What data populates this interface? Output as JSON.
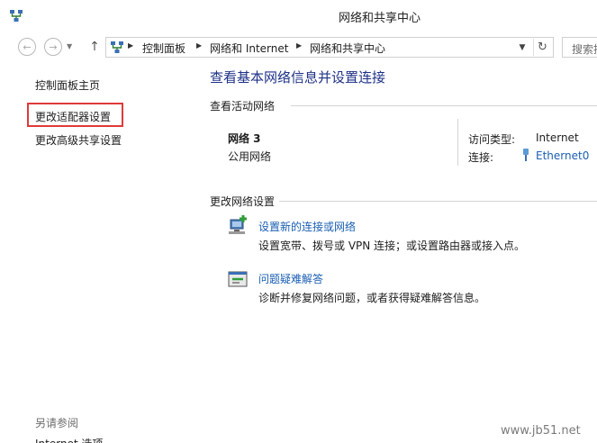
{
  "window": {
    "title": "网络和共享中心",
    "app_icon": "network-icon"
  },
  "nav": {
    "back_icon": "back-arrow-icon",
    "forward_icon": "forward-arrow-icon",
    "up_icon": "up-arrow-icon"
  },
  "address": {
    "crumbs": [
      "控制面板",
      "网络和 Internet",
      "网络和共享中心"
    ],
    "dropdown_icon": "chevron-down-icon",
    "refresh_icon": "refresh-icon"
  },
  "search": {
    "placeholder": "搜索控"
  },
  "sidebar": {
    "items": [
      {
        "label": "控制面板主页"
      },
      {
        "label": "更改适配器设置",
        "highlighted": true
      },
      {
        "label": "更改高级共享设置"
      }
    ],
    "see_also": "另请参阅",
    "see_also_items": [
      {
        "label": "Internet 选项"
      }
    ],
    "highlight_color": "#e03a3a"
  },
  "main": {
    "title": "查看基本网络信息并设置连接",
    "active_networks_header": "查看活动网络",
    "network": {
      "name": "网络  3",
      "category": "公用网络",
      "access_type_label": "访问类型:",
      "access_type_value": "Internet",
      "connection_label": "连接:",
      "connection_value": "Ethernet0",
      "connection_icon": "ethernet-icon"
    },
    "change_settings_header": "更改网络设置",
    "tasks": [
      {
        "icon": "new-connection-icon",
        "link": "设置新的连接或网络",
        "desc": "设置宽带、拨号或 VPN 连接；或设置路由器或接入点。"
      },
      {
        "icon": "troubleshoot-icon",
        "link": "问题疑难解答",
        "desc": "诊断并修复网络问题，或者获得疑难解答信息。"
      }
    ]
  },
  "colors": {
    "link": "#1a5fb4",
    "title": "#1e3287"
  },
  "watermark": "www.jb51.net"
}
